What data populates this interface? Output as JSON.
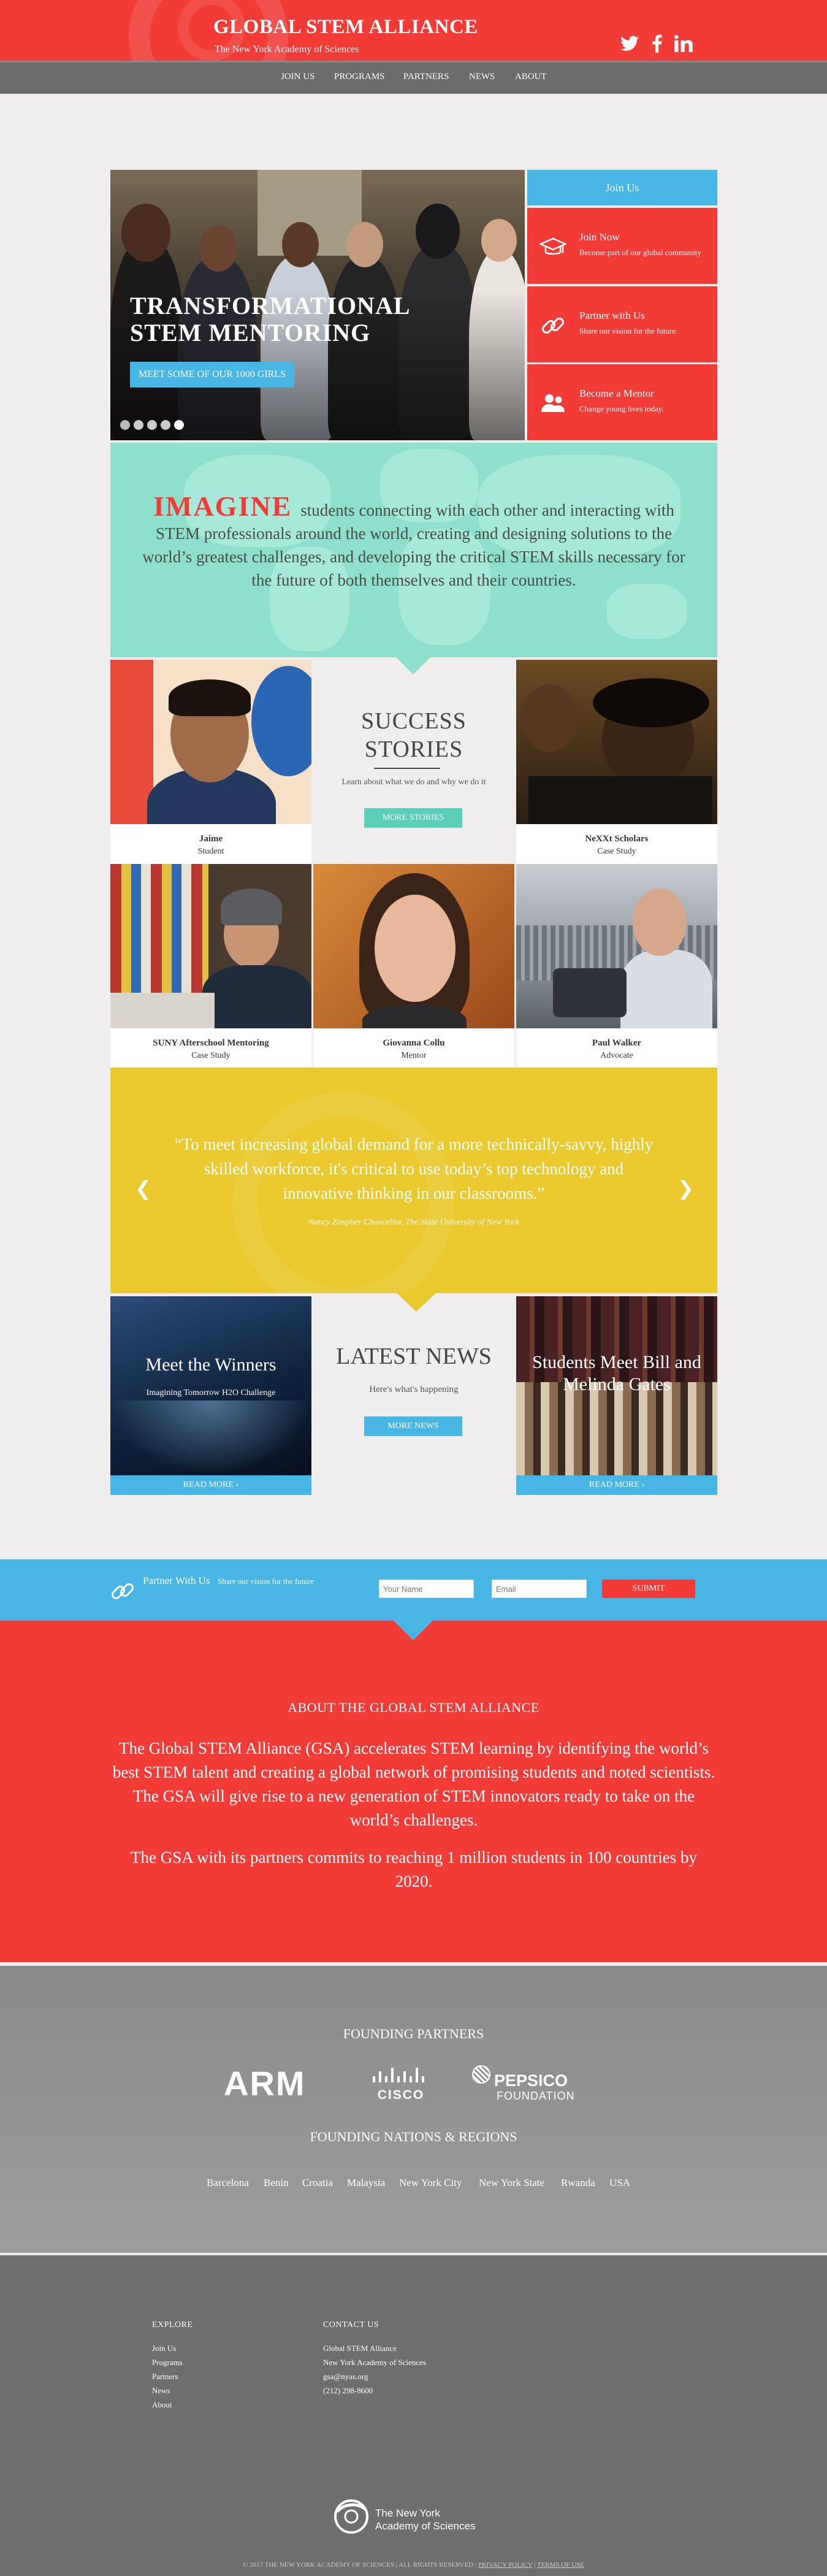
{
  "header": {
    "title": "GLOBAL STEM ALLIANCE",
    "subtitle": "The New York Academy of Sciences",
    "social": [
      "twitter-icon",
      "facebook-icon",
      "linkedin-icon"
    ]
  },
  "nav": {
    "items": [
      "JOIN US",
      "PROGRAMS",
      "PARTNERS",
      "NEWS",
      "ABOUT"
    ]
  },
  "hero": {
    "title_line1": "TRANSFORMATIONAL",
    "title_line2": "STEM MENTORING",
    "button": "MEET SOME OF OUR 1000 GIRLS",
    "slides": 5
  },
  "join": {
    "heading": "Join Us",
    "cards": [
      {
        "title": "Join Now",
        "subtitle": "Become part of our global community",
        "icon": "graduation-cap-icon"
      },
      {
        "title": "Partner with Us",
        "subtitle": "Share our vision for the future.",
        "icon": "link-icon"
      },
      {
        "title": "Become a Mentor",
        "subtitle": "Change young lives today.",
        "icon": "people-icon"
      }
    ]
  },
  "imagine": {
    "word": "IMAGINE",
    "text": "students connecting with each other and interacting with STEM professionals around the world, creating and designing solutions to the world’s greatest challenges, and developing the critical STEM skills necessary for the future of both themselves and their countries."
  },
  "stories": {
    "title_line1": "SUCCESS",
    "title_line2": "STORIES",
    "subtitle": "Learn about what we do and why we do it",
    "button": "MORE STORIES",
    "items": [
      {
        "name": "Jaime",
        "role": "Student"
      },
      {
        "name": "NeXXt Scholars",
        "role": "Case Study"
      },
      {
        "name": "SUNY Afterschool Mentoring",
        "role": "Case Study"
      },
      {
        "name": "Giovanna Collu",
        "role": "Mentor"
      },
      {
        "name": "Paul Walker",
        "role": "Advocate"
      }
    ]
  },
  "quote": {
    "text": "“To meet increasing global demand for a more technically-savvy, highly skilled workforce, it's critical to use today’s top technology and innovative thinking in our classrooms.”",
    "attribution": "Nancy Zimpher Chancellor, The State University of New York"
  },
  "news": {
    "title": "LATEST NEWS",
    "subtitle": "Here's what's happening",
    "button": "MORE NEWS",
    "left": {
      "title": "Meet the Winners",
      "subtitle": "Imagining Tomorrow H2O Challenge",
      "button": "READ MORE"
    },
    "right": {
      "title": "Students Meet Bill and Melinda Gates",
      "button": "READ MORE"
    }
  },
  "partner_bar": {
    "label": "Partner With Us",
    "tagline": "Share our vision for the future",
    "name_placeholder": "Your Name",
    "email_placeholder": "Email",
    "submit": "SUBMIT"
  },
  "about": {
    "title": "ABOUT THE GLOBAL STEM ALLIANCE",
    "p1": "The Global STEM Alliance (GSA) accelerates STEM learning by identifying the world’s best STEM talent and creating a global network of promising students and noted scientists. The GSA will give rise to a new generation of STEM innovators ready to take on the world’s challenges.",
    "p2": "The GSA with its partners commits to reaching 1 million students in 100 countries by 2020."
  },
  "partners": {
    "title": "FOUNDING PARTNERS",
    "logos": {
      "arm": "ARM",
      "cisco": "CISCO",
      "pepsico": "PEPSICO",
      "pepsico_sub": "FOUNDATION"
    },
    "nations_title": "FOUNDING NATIONS & REGIONS",
    "nations": [
      "Barcelona",
      "Benin",
      "Croatia",
      "Malaysia",
      "New York City",
      "New York State",
      "Rwanda",
      "USA"
    ]
  },
  "footer": {
    "explore_title": "EXPLORE",
    "explore": [
      "Join Us",
      "Programs",
      "Partners",
      "News",
      "About"
    ],
    "contact_title": "CONTACT US",
    "contact": [
      "Global STEM Alliance",
      "New York Academy of Sciences",
      "gsa@nyas.org",
      "(212) 298-8600"
    ],
    "logo_line1": "The New York",
    "logo_line2": "Academy of Sciences",
    "copyright": "© 2017 THE NEW YORK ACADEMY OF SCIENCES | ALL RIGHTS RESERVED |",
    "privacy": "PRIVACY POLICY",
    "separator": "|",
    "terms": "TERMS OF USE"
  },
  "colors": {
    "red": "#f23a36",
    "blue": "#48b6e5",
    "teal": "#8ee0cc",
    "yellow": "#e9c92e",
    "gray": "#6e6e6e"
  }
}
